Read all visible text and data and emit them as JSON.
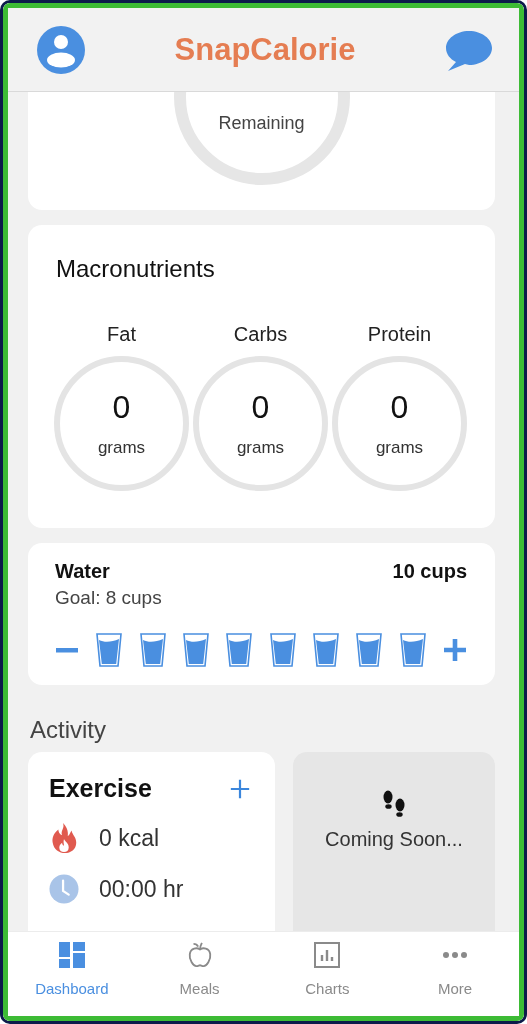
{
  "app": {
    "title": "SnapCalorie"
  },
  "calories": {
    "caption": "Remaining"
  },
  "macronutrients": {
    "title": "Macronutrients",
    "items": [
      {
        "label": "Fat",
        "value": "0",
        "unit": "grams"
      },
      {
        "label": "Carbs",
        "value": "0",
        "unit": "grams"
      },
      {
        "label": "Protein",
        "value": "0",
        "unit": "grams"
      }
    ]
  },
  "water": {
    "title": "Water",
    "total": "10 cups",
    "goal": "Goal: 8 cups",
    "glasses": [
      {
        "filled": true
      },
      {
        "filled": true
      },
      {
        "filled": true
      },
      {
        "filled": true
      },
      {
        "filled": true
      },
      {
        "filled": true
      },
      {
        "filled": true
      },
      {
        "filled": true
      }
    ]
  },
  "activity": {
    "title": "Activity",
    "exercise": {
      "title": "Exercise",
      "rows": [
        {
          "kind": "calories",
          "value": "0 kcal"
        },
        {
          "kind": "time",
          "value": "00:00 hr"
        }
      ]
    },
    "steps": {
      "text": "Coming Soon..."
    }
  },
  "tabs": [
    {
      "label": "Dashboard",
      "kind": "dashboard",
      "selected": true
    },
    {
      "label": "Meals",
      "kind": "meals",
      "selected": false
    },
    {
      "label": "Charts",
      "kind": "charts",
      "selected": false
    },
    {
      "label": "More",
      "kind": "more",
      "selected": false
    }
  ]
}
